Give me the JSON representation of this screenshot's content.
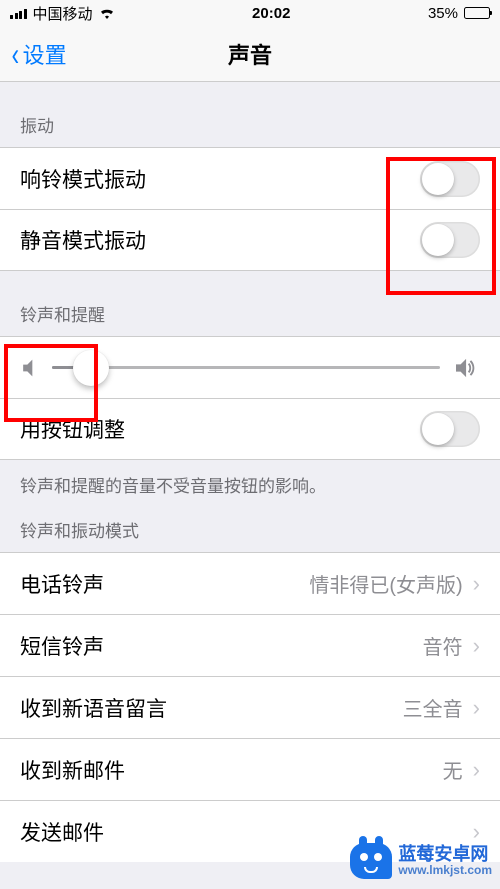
{
  "status": {
    "carrier": "中国移动",
    "time": "20:02",
    "battery_pct_text": "35%",
    "battery_fill_pct": 35
  },
  "nav": {
    "back_label": "设置",
    "title": "声音"
  },
  "vibration": {
    "header": "振动",
    "rows": {
      "ring_vibrate": "响铃模式振动",
      "silent_vibrate": "静音模式振动"
    }
  },
  "ringtone_alert": {
    "header": "铃声和提醒",
    "slider_pct": 10,
    "button_adjust_label": "用按钮调整",
    "footer": "铃声和提醒的音量不受音量按钮的影响。"
  },
  "patterns": {
    "header": "铃声和振动模式",
    "rows": [
      {
        "label": "电话铃声",
        "value": "情非得已(女声版)"
      },
      {
        "label": "短信铃声",
        "value": "音符"
      },
      {
        "label": "收到新语音留言",
        "value": "三全音"
      },
      {
        "label": "收到新邮件",
        "value": "无"
      },
      {
        "label": "发送邮件",
        "value": ""
      }
    ]
  },
  "watermark": {
    "title": "蓝莓安卓网",
    "url": "www.lmkjst.com"
  }
}
